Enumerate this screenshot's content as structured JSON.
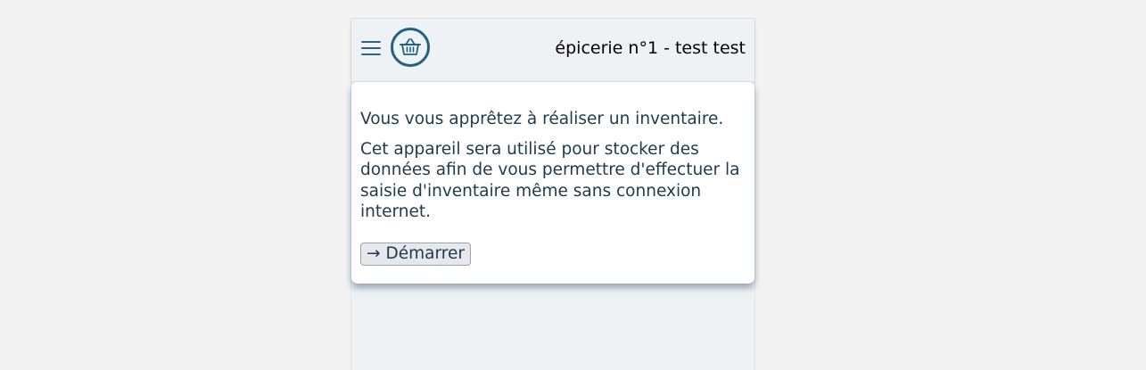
{
  "header": {
    "menu_icon": "hamburger-menu-icon",
    "logo_icon": "shopping-basket-icon",
    "store_name": "épicerie n°1 - test test",
    "accent_color": "#24607f"
  },
  "card": {
    "intro": "Vous vous apprêtez à réaliser un inventaire.",
    "description": "Cet appareil sera utilisé pour stocker des données afin de vous permettre d'effectuer la saisie d'inventaire même sans connexion internet.",
    "start_button": {
      "icon": "arrow-right-icon",
      "arrow": "→",
      "label": "Démarrer"
    }
  }
}
